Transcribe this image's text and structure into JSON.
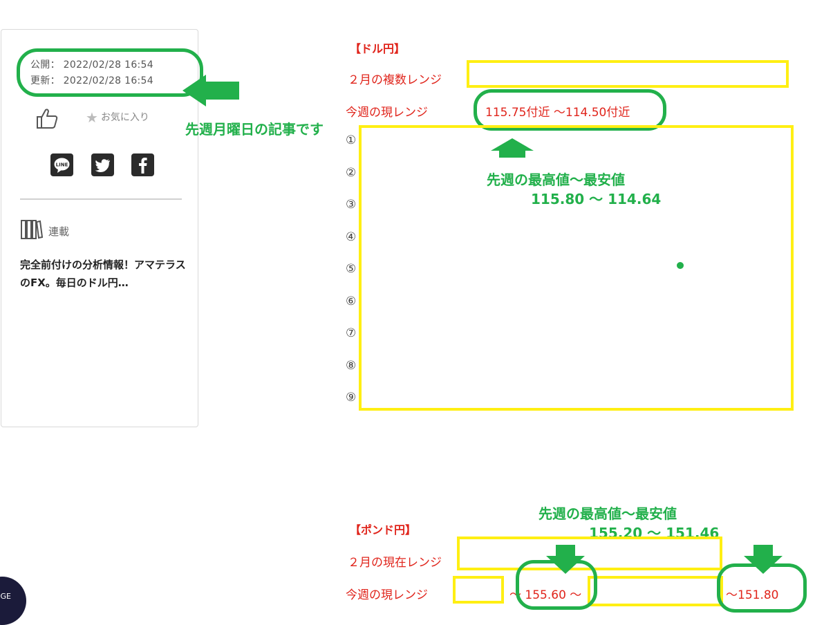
{
  "meta": {
    "published_label": "公開：",
    "published_date": "2022/02/28 16:54",
    "updated_label": "更新：",
    "updated_date": "2022/02/28 16:54"
  },
  "actions": {
    "favorite_label": "お気に入り"
  },
  "series": {
    "label": "連載",
    "title": "完全前付けの分析情報！アマテラスのFX。毎日のドル円…"
  },
  "annotations": {
    "article_note": "先週月曜日の記事です",
    "usd_high_low_title": "先週の最高値〜最安値",
    "usd_high_low_values": "115.80 〜 114.64",
    "gbp_high_low_title": "先週の最高値〜最安値",
    "gbp_high_low_values": "155.20 〜 151.46"
  },
  "usdjpy": {
    "heading": "【ドル円】",
    "feb_range_label": "２月の複数レンジ",
    "week_range_label": "今週の現レンジ",
    "week_range_value": "115.75付近 〜114.50付近",
    "numbers": [
      "①",
      "②",
      "③",
      "④",
      "⑤",
      "⑥",
      "⑦",
      "⑧",
      "⑨"
    ]
  },
  "gbpjpy": {
    "heading": "【ポンド円】",
    "feb_range_label": "２月の現在レンジ",
    "week_range_label": "今週の現レンジ",
    "week_range_mid": "〜 155.60 〜",
    "week_range_end": "〜151.80"
  },
  "page_badge": "GE",
  "colors": {
    "annotation_green": "#22b04b",
    "highlight_yellow": "#ffef13",
    "text_red": "#e0241b"
  }
}
